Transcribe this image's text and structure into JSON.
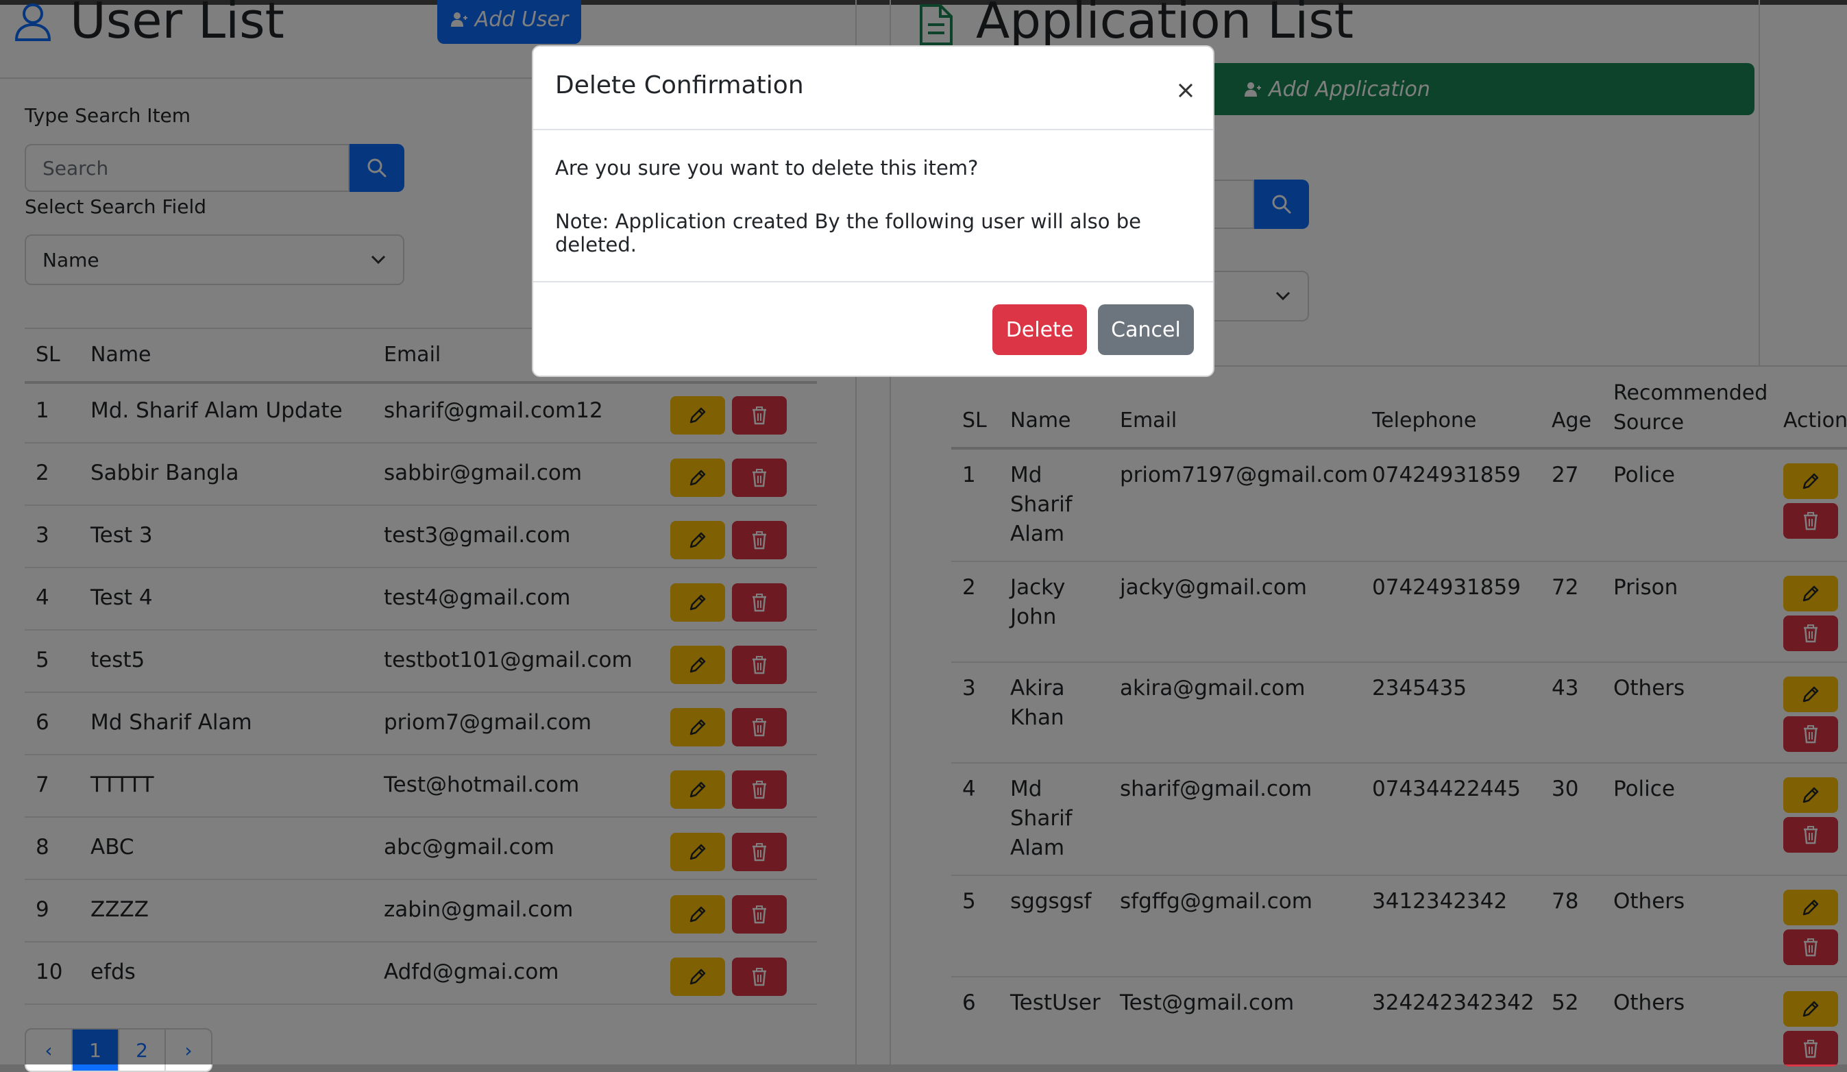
{
  "user_panel": {
    "title": "User List",
    "add_label": "Add User",
    "search_label": "Type Search Item",
    "search_placeholder": "Search",
    "field_label": "Select Search Field",
    "field_value": "Name",
    "columns": [
      "SL",
      "Name",
      "Email"
    ],
    "rows": [
      {
        "sl": "1",
        "name": "Md. Sharif Alam Update",
        "email": "sharif@gmail.com12"
      },
      {
        "sl": "2",
        "name": "Sabbir Bangla",
        "email": "sabbir@gmail.com"
      },
      {
        "sl": "3",
        "name": "Test 3",
        "email": "test3@gmail.com"
      },
      {
        "sl": "4",
        "name": "Test 4",
        "email": "test4@gmail.com"
      },
      {
        "sl": "5",
        "name": "test5",
        "email": "testbot101@gmail.com"
      },
      {
        "sl": "6",
        "name": "Md Sharif Alam",
        "email": "priom7@gmail.com"
      },
      {
        "sl": "7",
        "name": "TTTTT",
        "email": "Test@hotmail.com"
      },
      {
        "sl": "8",
        "name": "ABC",
        "email": "abc@gmail.com"
      },
      {
        "sl": "9",
        "name": "ZZZZ",
        "email": "zabin@gmail.com"
      },
      {
        "sl": "10",
        "name": "efds",
        "email": "Adfd@gmai.com"
      }
    ],
    "pagination": {
      "prev": "‹",
      "pages": [
        "1",
        "2"
      ],
      "next": "›",
      "active": "1"
    }
  },
  "app_panel": {
    "title": "Application List",
    "add_label": "Add Application",
    "columns": [
      "SL",
      "Name",
      "Email",
      "Telephone",
      "Age",
      "Recommended Source",
      "Action"
    ],
    "rows": [
      {
        "sl": "1",
        "name": "Md Sharif Alam",
        "email": "priom7197@gmail.com",
        "telephone": "07424931859",
        "age": "27",
        "source": "Police"
      },
      {
        "sl": "2",
        "name": "Jacky John",
        "email": "jacky@gmail.com",
        "telephone": "07424931859",
        "age": "72",
        "source": "Prison"
      },
      {
        "sl": "3",
        "name": "Akira Khan",
        "email": "akira@gmail.com",
        "telephone": "2345435",
        "age": "43",
        "source": "Others"
      },
      {
        "sl": "4",
        "name": "Md Sharif Alam",
        "email": "sharif@gmail.com",
        "telephone": "07434422445",
        "age": "30",
        "source": "Police"
      },
      {
        "sl": "5",
        "name": "sggsgsf",
        "email": "sfgffg@gmail.com",
        "telephone": "3412342342",
        "age": "78",
        "source": "Others"
      },
      {
        "sl": "6",
        "name": "TestUser",
        "email": "Test@gmail.com",
        "telephone": "324242342342",
        "age": "52",
        "source": "Others"
      }
    ]
  },
  "modal": {
    "title": "Delete Confirmation",
    "close_icon": "close-icon",
    "message": "Are you sure you want to delete this item?",
    "note": "Note: Application created By the following user will also be deleted.",
    "delete_label": "Delete",
    "cancel_label": "Cancel"
  },
  "colors": {
    "primary": "#0d6efd",
    "success": "#198754",
    "warning": "#ffc107",
    "danger": "#dc3545",
    "secondary": "#6c757d"
  },
  "icons": [
    "user-icon",
    "user-plus-icon",
    "document-icon",
    "search-icon",
    "chevron-down-icon",
    "pencil-icon",
    "trash-icon",
    "close-icon"
  ]
}
